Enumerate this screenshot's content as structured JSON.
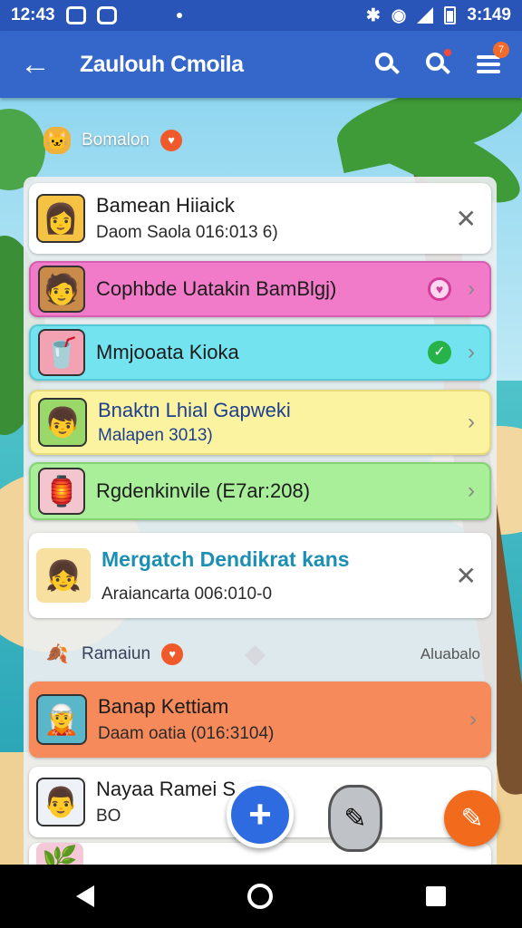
{
  "status_bar": {
    "time_left": "12:43",
    "time_right": "3:149"
  },
  "app_bar": {
    "title": "Zaulouh Cmoila"
  },
  "sections": [
    {
      "label": "Bomalon"
    },
    {
      "label": "Ramaiun",
      "action": "Aluabalo"
    }
  ],
  "cards": [
    {
      "name": "Bamean Hiiaick",
      "sub": "Daom Saola 016:013 6)",
      "bg": "#ffffff",
      "trail": "close"
    },
    {
      "name": "Cophbde  Uatakin BamBlgj)",
      "sub": "",
      "bg": "#f27bc9",
      "trail": "heart"
    },
    {
      "name": "Mmjooata Kioka",
      "sub": "",
      "bg": "#72e3ef",
      "trail": "check"
    },
    {
      "name": "Bnaktn Lhial Gapweki",
      "sub": "Malapen 3013)",
      "bg": "#fbf3a0",
      "trail": "chevron"
    },
    {
      "name": "Rgdenkinvile (E7ar:208)",
      "sub": "",
      "bg": "#a9ef9a",
      "trail": "chevron"
    },
    {
      "name": "Mergatch Dendikrat kans",
      "sub": "Araiancarta 006:010-0",
      "bg": "#ffffff",
      "trail": "close"
    },
    {
      "name": "Banap Kettiam",
      "sub": "Daam oatia (016:3104)",
      "bg": "#f78a5a",
      "trail": "chevron"
    },
    {
      "name": "Nayaa Ramei S",
      "sub": "BO",
      "bg": "#ffffff",
      "trail": "chevron"
    }
  ],
  "colors": {
    "appbar": "#3566c9",
    "status": "#2a55b8",
    "fab_blue": "#2e6ae0",
    "fab_orange": "#f26a1b"
  },
  "icons": [
    "back-arrow-icon",
    "search-icon",
    "notification-search-icon",
    "list-menu-icon",
    "add-fab-icon",
    "pencil-icon",
    "edit-fab-icon"
  ]
}
